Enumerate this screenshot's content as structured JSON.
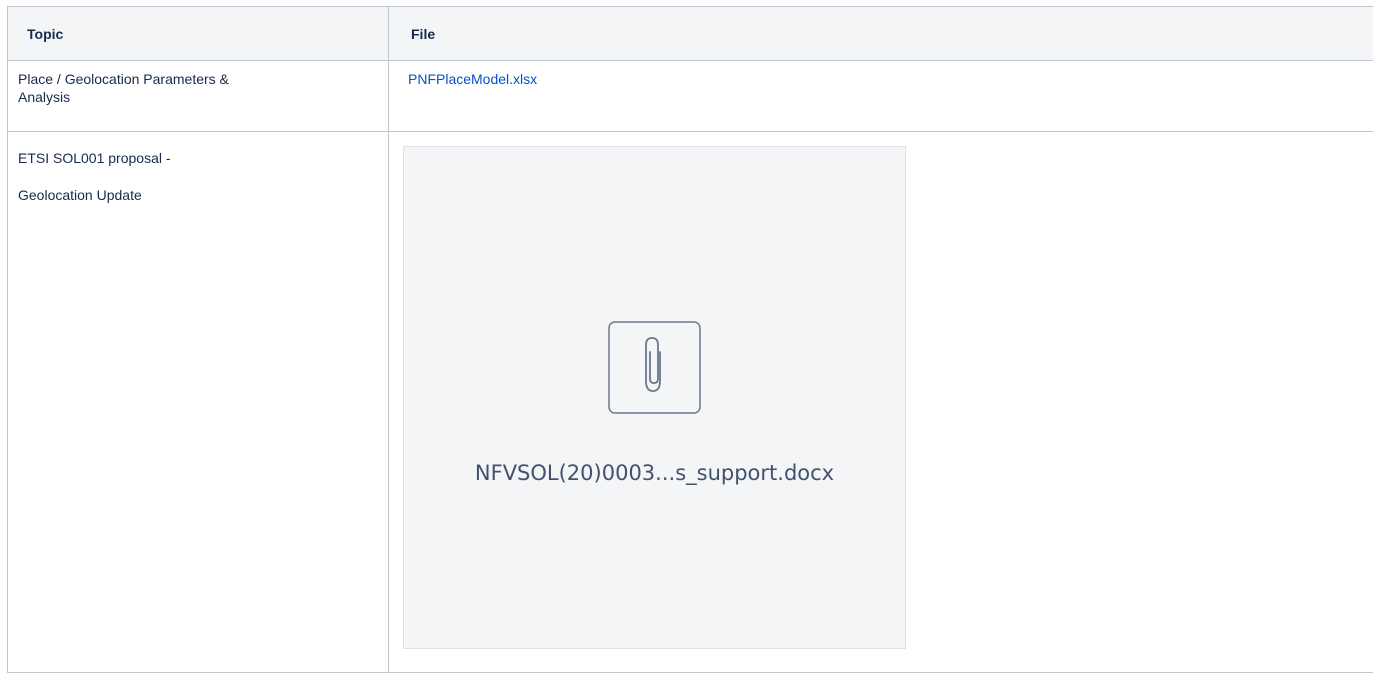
{
  "table": {
    "headers": [
      "Topic",
      "File"
    ],
    "rows": [
      {
        "topic_lines": [
          "Place / Geolocation Parameters &",
          "Analysis"
        ],
        "file_link": "PNFPlaceModel.xlsx"
      },
      {
        "topic_lines": [
          "ETSI SOL001 proposal -",
          "Geolocation Update"
        ],
        "attachment": {
          "icon": "paperclip-icon",
          "name": "NFVSOL(20)0003...s_support.docx"
        }
      }
    ]
  },
  "colors": {
    "link": "#0052cc",
    "header_bg": "#f4f5f7",
    "border": "#c1c7d0",
    "text": "#172b4d"
  }
}
